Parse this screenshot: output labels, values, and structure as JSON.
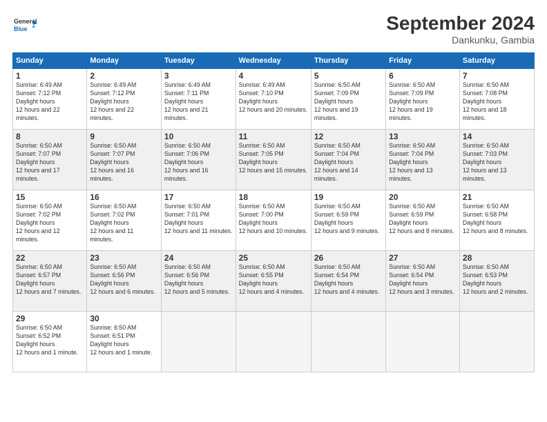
{
  "header": {
    "logo_line1": "General",
    "logo_line2": "Blue",
    "month": "September 2024",
    "location": "Dankunku, Gambia"
  },
  "weekdays": [
    "Sunday",
    "Monday",
    "Tuesday",
    "Wednesday",
    "Thursday",
    "Friday",
    "Saturday"
  ],
  "weeks": [
    [
      {
        "day": "1",
        "sr": "6:49 AM",
        "ss": "7:12 PM",
        "dl": "12 hours and 22 minutes."
      },
      {
        "day": "2",
        "sr": "6:49 AM",
        "ss": "7:12 PM",
        "dl": "12 hours and 22 minutes."
      },
      {
        "day": "3",
        "sr": "6:49 AM",
        "ss": "7:11 PM",
        "dl": "12 hours and 21 minutes."
      },
      {
        "day": "4",
        "sr": "6:49 AM",
        "ss": "7:10 PM",
        "dl": "12 hours and 20 minutes."
      },
      {
        "day": "5",
        "sr": "6:50 AM",
        "ss": "7:09 PM",
        "dl": "12 hours and 19 minutes."
      },
      {
        "day": "6",
        "sr": "6:50 AM",
        "ss": "7:09 PM",
        "dl": "12 hours and 19 minutes."
      },
      {
        "day": "7",
        "sr": "6:50 AM",
        "ss": "7:08 PM",
        "dl": "12 hours and 18 minutes."
      }
    ],
    [
      {
        "day": "8",
        "sr": "6:50 AM",
        "ss": "7:07 PM",
        "dl": "12 hours and 17 minutes."
      },
      {
        "day": "9",
        "sr": "6:50 AM",
        "ss": "7:07 PM",
        "dl": "12 hours and 16 minutes."
      },
      {
        "day": "10",
        "sr": "6:50 AM",
        "ss": "7:06 PM",
        "dl": "12 hours and 16 minutes."
      },
      {
        "day": "11",
        "sr": "6:50 AM",
        "ss": "7:05 PM",
        "dl": "12 hours and 15 minutes."
      },
      {
        "day": "12",
        "sr": "6:50 AM",
        "ss": "7:04 PM",
        "dl": "12 hours and 14 minutes."
      },
      {
        "day": "13",
        "sr": "6:50 AM",
        "ss": "7:04 PM",
        "dl": "12 hours and 13 minutes."
      },
      {
        "day": "14",
        "sr": "6:50 AM",
        "ss": "7:03 PM",
        "dl": "12 hours and 13 minutes."
      }
    ],
    [
      {
        "day": "15",
        "sr": "6:50 AM",
        "ss": "7:02 PM",
        "dl": "12 hours and 12 minutes."
      },
      {
        "day": "16",
        "sr": "6:50 AM",
        "ss": "7:02 PM",
        "dl": "12 hours and 11 minutes."
      },
      {
        "day": "17",
        "sr": "6:50 AM",
        "ss": "7:01 PM",
        "dl": "12 hours and 11 minutes."
      },
      {
        "day": "18",
        "sr": "6:50 AM",
        "ss": "7:00 PM",
        "dl": "12 hours and 10 minutes."
      },
      {
        "day": "19",
        "sr": "6:50 AM",
        "ss": "6:59 PM",
        "dl": "12 hours and 9 minutes."
      },
      {
        "day": "20",
        "sr": "6:50 AM",
        "ss": "6:59 PM",
        "dl": "12 hours and 8 minutes."
      },
      {
        "day": "21",
        "sr": "6:50 AM",
        "ss": "6:58 PM",
        "dl": "12 hours and 8 minutes."
      }
    ],
    [
      {
        "day": "22",
        "sr": "6:50 AM",
        "ss": "6:57 PM",
        "dl": "12 hours and 7 minutes."
      },
      {
        "day": "23",
        "sr": "6:50 AM",
        "ss": "6:56 PM",
        "dl": "12 hours and 6 minutes."
      },
      {
        "day": "24",
        "sr": "6:50 AM",
        "ss": "6:56 PM",
        "dl": "12 hours and 5 minutes."
      },
      {
        "day": "25",
        "sr": "6:50 AM",
        "ss": "6:55 PM",
        "dl": "12 hours and 4 minutes."
      },
      {
        "day": "26",
        "sr": "6:50 AM",
        "ss": "6:54 PM",
        "dl": "12 hours and 4 minutes."
      },
      {
        "day": "27",
        "sr": "6:50 AM",
        "ss": "6:54 PM",
        "dl": "12 hours and 3 minutes."
      },
      {
        "day": "28",
        "sr": "6:50 AM",
        "ss": "6:53 PM",
        "dl": "12 hours and 2 minutes."
      }
    ],
    [
      {
        "day": "29",
        "sr": "6:50 AM",
        "ss": "6:52 PM",
        "dl": "12 hours and 1 minute."
      },
      {
        "day": "30",
        "sr": "6:50 AM",
        "ss": "6:51 PM",
        "dl": "12 hours and 1 minute."
      },
      null,
      null,
      null,
      null,
      null
    ]
  ]
}
